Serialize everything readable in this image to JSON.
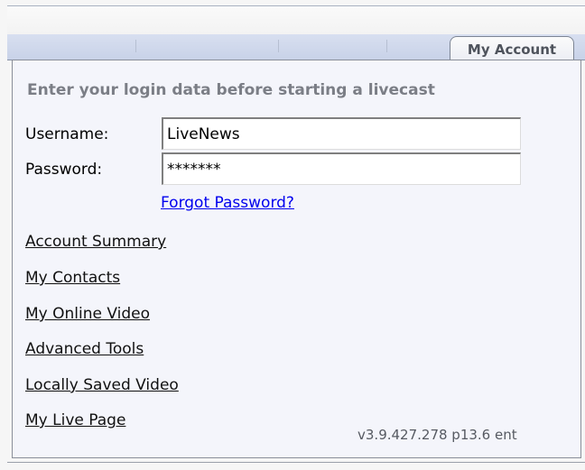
{
  "tab": {
    "label": "My Account"
  },
  "login": {
    "heading": "Enter your login data before starting a livecast",
    "username_label": "Username:",
    "username_value": "LiveNews",
    "password_label": "Password:",
    "password_value": "*******",
    "forgot_label": "Forgot Password?"
  },
  "links": {
    "account_summary": "Account Summary",
    "my_contacts": "My Contacts",
    "my_online_video": "My Online Video",
    "advanced_tools": "Advanced Tools",
    "locally_saved_video": "Locally Saved Video",
    "my_live_page": "My Live Page"
  },
  "version": "v3.9.427.278 p13.6 ent",
  "colors": {
    "link_blue": "#0000ee",
    "heading_gray": "#7b7e86",
    "tab_strip": "#c8d2e8"
  }
}
